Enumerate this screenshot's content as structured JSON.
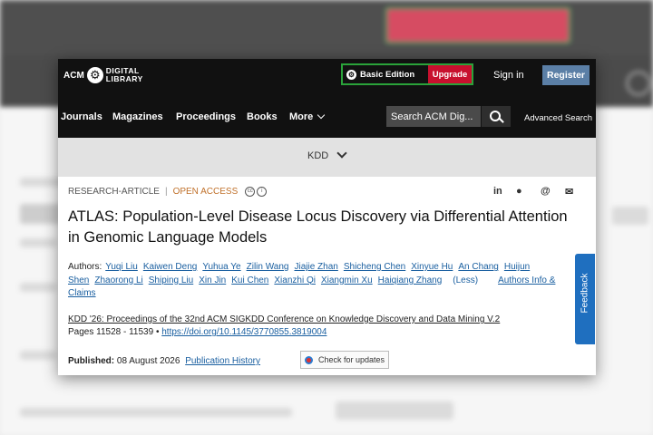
{
  "header": {
    "logo_acm": "ACM",
    "logo_dl_line1": "DIGITAL",
    "logo_dl_line2": "LIBRARY",
    "basic_edition": "Basic Edition",
    "upgrade": "Upgrade",
    "sign_in": "Sign in",
    "register": "Register"
  },
  "nav": {
    "items": [
      "Journals",
      "Magazines",
      "Proceedings",
      "Books",
      "More"
    ],
    "search_placeholder": "Search ACM Dig...",
    "advanced_search": "Advanced Search"
  },
  "venue_bar": {
    "label": "KDD"
  },
  "article": {
    "type": "RESEARCH-ARTICLE",
    "access": "OPEN ACCESS",
    "title": "ATLAS: Population-Level Disease Locus Discovery via Differential Attention in Genomic Language Models",
    "authors_label": "Authors:",
    "authors": [
      "Yuqi Liu",
      "Kaiwen Deng",
      "Yuhua Ye",
      "Zilin Wang",
      "Jiajie Zhan",
      "Shicheng Chen",
      "Xinyue Hu",
      "An Chang",
      "Huijun Shen",
      "Zhaorong Li",
      "Shiping Liu",
      "Xin Jin",
      "Kui Chen",
      "Xianzhi Qi",
      "Xiangmin Xu",
      "Haiqiang Zhang"
    ],
    "less": "(Less)",
    "authors_info": "Authors Info & Claims",
    "conference": "KDD '26: Proceedings of the 32nd ACM SIGKDD Conference on Knowledge Discovery and Data Mining V.2",
    "pages": "Pages 11528 - 11539",
    "bullet": "•",
    "doi": "https://doi.org/10.1145/3770855.3819004",
    "published_label": "Published:",
    "published_date": "08 August 2026",
    "publication_history": "Publication History",
    "check_updates": "Check for updates"
  },
  "share_icons": [
    "linkedin-icon",
    "reddit-icon",
    "threads-icon",
    "email-icon"
  ],
  "feedback": "Feedback",
  "colors": {
    "upgrade_red": "#c8102e",
    "register_blue": "#5b7fa6",
    "open_access": "#c0712b",
    "link_blue": "#1a5fa0",
    "feedback_blue": "#1f6fbf"
  }
}
